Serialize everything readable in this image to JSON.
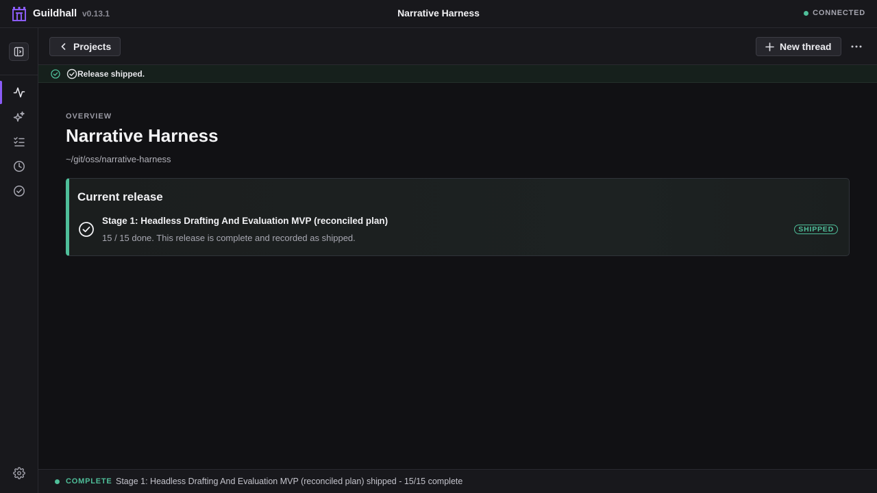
{
  "app": {
    "name": "Guildhall",
    "version": "v0.13.1",
    "window_title": "Narrative Harness",
    "connection_status": "CONNECTED",
    "brand_color": "#8b5cf6",
    "success_color": "#4fbf9a"
  },
  "sidebar": {
    "toggle_icon": "sidebar-toggle-icon",
    "items": [
      {
        "icon": "activity-icon",
        "active": true
      },
      {
        "icon": "sparkles-icon",
        "active": false
      },
      {
        "icon": "checklist-icon",
        "active": false
      },
      {
        "icon": "clock-icon",
        "active": false
      },
      {
        "icon": "check-circle-icon",
        "active": false
      }
    ],
    "settings_icon": "gear-icon"
  },
  "toolbar": {
    "back_label": "Projects",
    "new_thread_label": "New thread",
    "more_label": "···"
  },
  "notice": {
    "text": "Release shipped."
  },
  "overview": {
    "overline": "OVERVIEW",
    "title": "Narrative Harness",
    "path": "~/git/oss/narrative-harness"
  },
  "release_card": {
    "heading": "Current release",
    "name": "Stage 1: Headless Drafting And Evaluation MVP (reconciled plan)",
    "description": "15 / 15 done. This release is complete and recorded as shipped.",
    "badge": "SHIPPED",
    "done": 15,
    "total": 15
  },
  "statusbar": {
    "label": "COMPLETE",
    "message": "Stage 1: Headless Drafting And Evaluation MVP (reconciled plan) shipped - 15/15 complete"
  }
}
